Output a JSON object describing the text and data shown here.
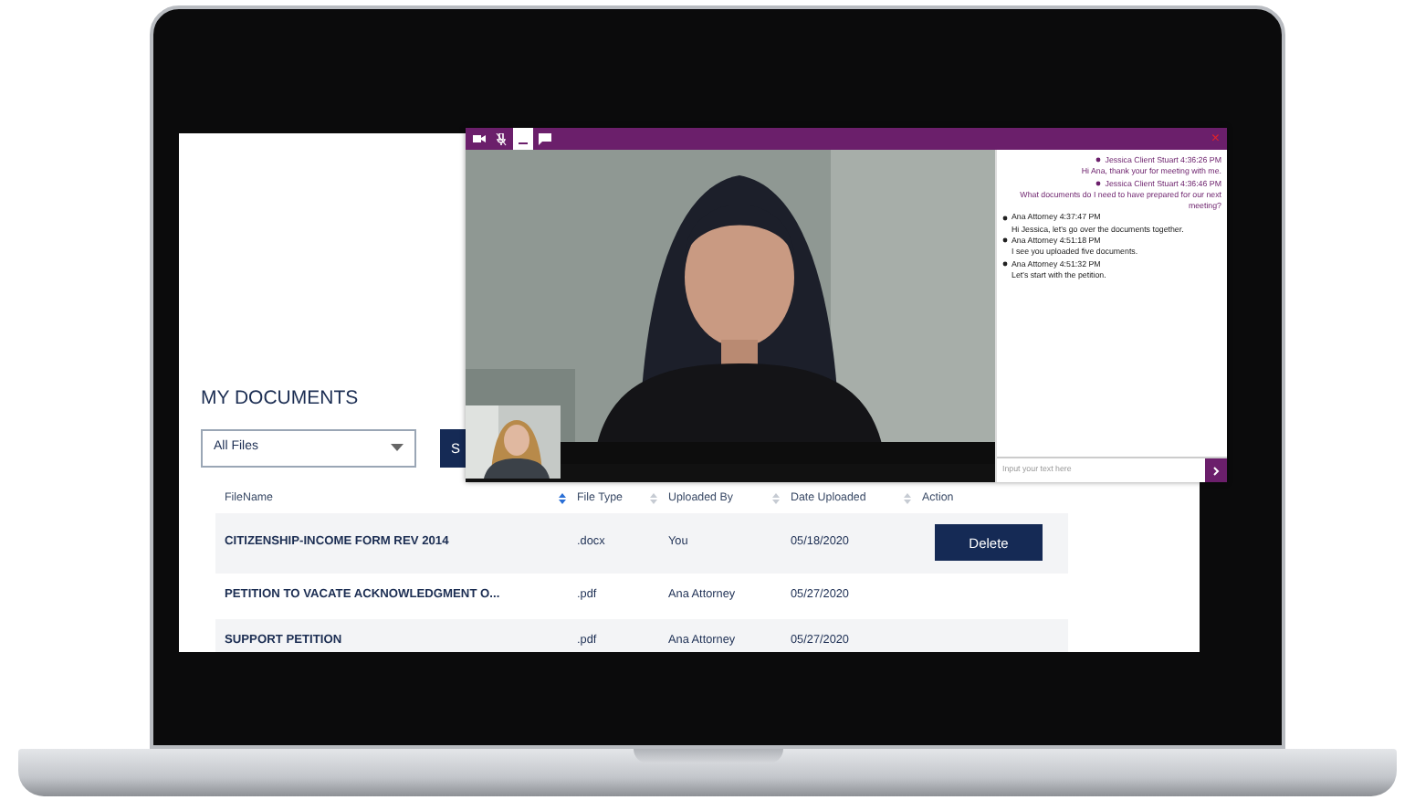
{
  "documents": {
    "title": "MY DOCUMENTS",
    "filter": {
      "value": "All Files"
    },
    "button": {
      "label": "S"
    },
    "columns": [
      {
        "label": "FileName",
        "sorted": true
      },
      {
        "label": "File Type",
        "sorted": false
      },
      {
        "label": "Uploaded By",
        "sorted": false
      },
      {
        "label": "Date Uploaded",
        "sorted": false
      },
      {
        "label": "Action"
      }
    ],
    "rows": [
      {
        "name": "CITIZENSHIP-INCOME FORM REV 2014",
        "type": ".docx",
        "uploaded_by": "You",
        "date": "05/18/2020",
        "action": "Delete"
      },
      {
        "name": "PETITION TO VACATE ACKNOWLEDGMENT O...",
        "type": ".pdf",
        "uploaded_by": "Ana Attorney",
        "date": "05/27/2020"
      },
      {
        "name": "SUPPORT PETITION",
        "type": ".pdf",
        "uploaded_by": "Ana Attorney",
        "date": "05/27/2020"
      }
    ]
  },
  "video_call": {
    "toolbar": [
      {
        "kind": "camera",
        "selected": false
      },
      {
        "kind": "mic-off",
        "selected": false
      },
      {
        "kind": "minimize",
        "selected": true
      },
      {
        "kind": "chat",
        "selected": false
      }
    ],
    "close": "×",
    "chat": [
      {
        "kind": "self",
        "sender": "Jessica Client Stuart 4:36:26 PM",
        "text": "Hi Ana, thank your for meeting with me."
      },
      {
        "kind": "self",
        "sender": "Jessica Client Stuart 4:36:46 PM",
        "text": "What documents do I need to have prepared for our next meeting?"
      },
      {
        "kind": "other",
        "sender": "Ana Attorney 4:37:47 PM",
        "text": "Hi Jessica, let's go over the documents together."
      },
      {
        "kind": "other",
        "sender": "Ana Attorney 4:51:18 PM",
        "text": "I see you uploaded five documents."
      },
      {
        "kind": "other",
        "sender": "Ana Attorney 4:51:32 PM",
        "text": "Let's start with the petition."
      }
    ],
    "input": {
      "placeholder": "Input your text here"
    }
  }
}
